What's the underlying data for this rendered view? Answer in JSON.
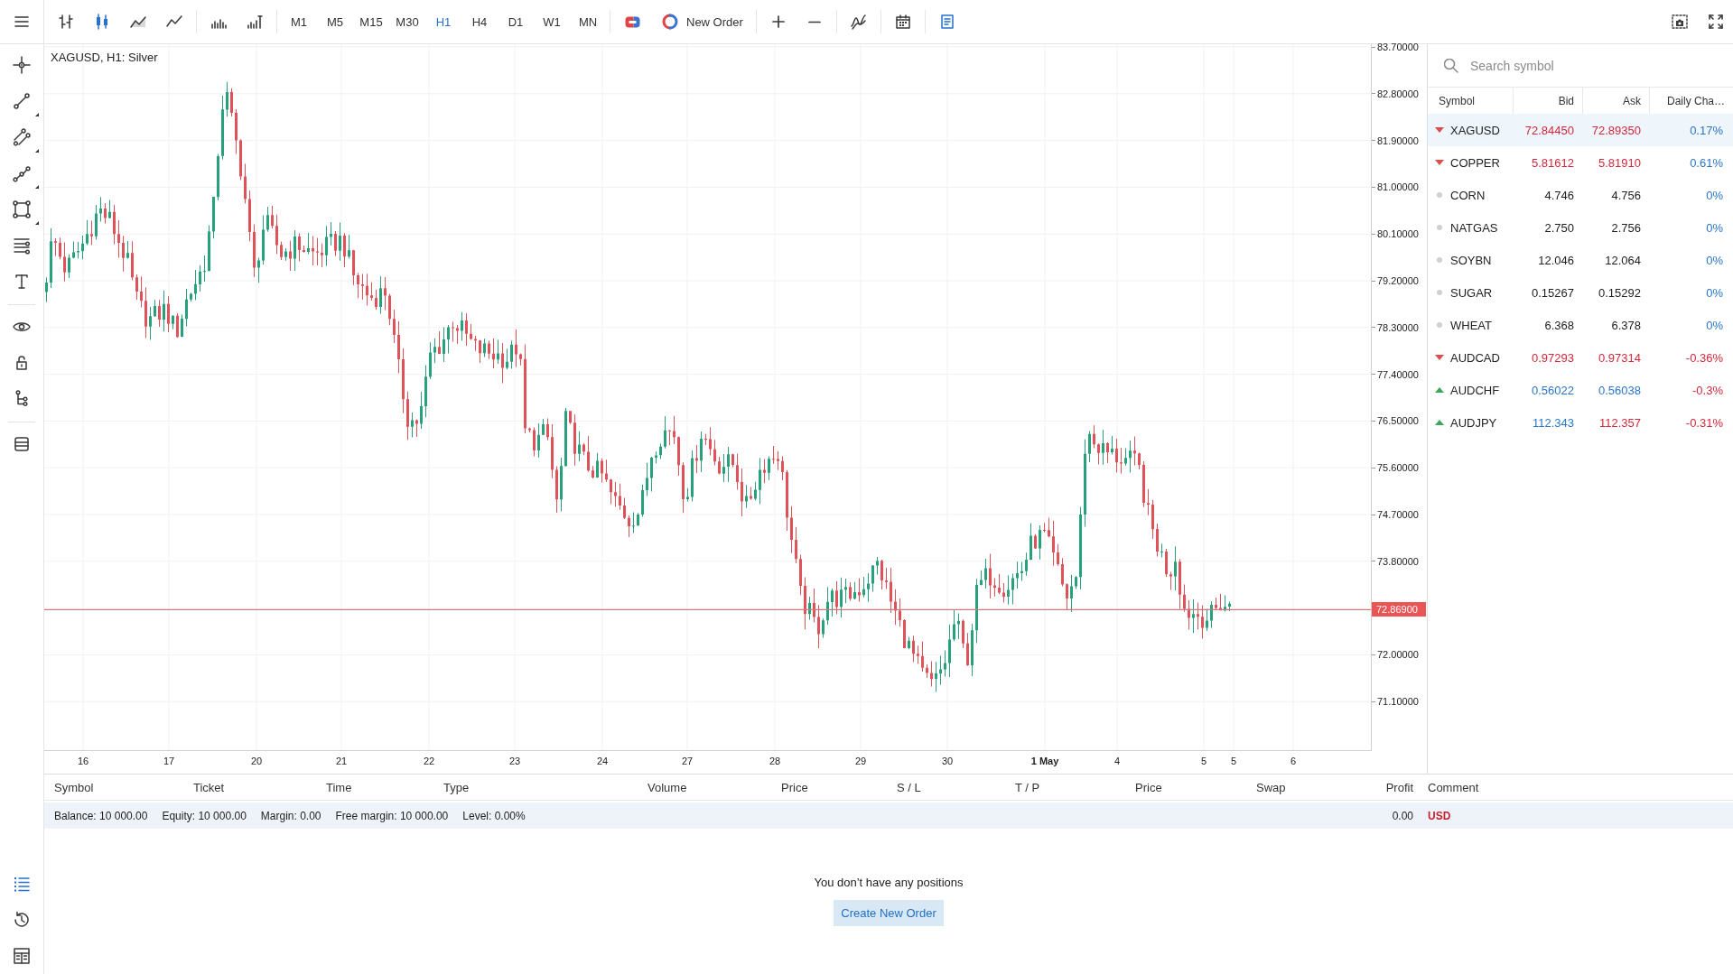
{
  "toolbar": {
    "chart_types": [
      {
        "kind": "bars",
        "selected": false
      },
      {
        "kind": "candles",
        "selected": true
      },
      {
        "kind": "area",
        "selected": false
      },
      {
        "kind": "line",
        "selected": false
      }
    ],
    "timeframes": [
      {
        "label": "M1",
        "selected": false
      },
      {
        "label": "M5",
        "selected": false
      },
      {
        "label": "M15",
        "selected": false
      },
      {
        "label": "M30",
        "selected": false
      },
      {
        "label": "H1",
        "selected": true
      },
      {
        "label": "H4",
        "selected": false
      },
      {
        "label": "D1",
        "selected": false
      },
      {
        "label": "W1",
        "selected": false
      },
      {
        "label": "MN",
        "selected": false
      }
    ],
    "new_order": {
      "label": "New Order"
    },
    "panel_toggle": {
      "on": true
    }
  },
  "sidebar": {
    "bottom_tabs": [
      {
        "kind": "positions",
        "selected": true
      },
      {
        "kind": "history",
        "selected": false
      },
      {
        "kind": "journal",
        "selected": false
      }
    ]
  },
  "chart": {
    "title": "XAGUSD, H1: Silver",
    "price_axis": [
      "83.70000",
      "82.80000",
      "81.90000",
      "81.00000",
      "80.10000",
      "79.20000",
      "78.30000",
      "77.40000",
      "76.50000",
      "75.60000",
      "74.70000",
      "73.80000",
      "72.00000",
      "71.10000"
    ],
    "current_price": "72.86900",
    "date_axis": [
      {
        "label": "16",
        "bold": false
      },
      {
        "label": "17",
        "bold": false
      },
      {
        "label": "20",
        "bold": false
      },
      {
        "label": "21",
        "bold": false
      },
      {
        "label": "22",
        "bold": false
      },
      {
        "label": "23",
        "bold": false
      },
      {
        "label": "24",
        "bold": false
      },
      {
        "label": "27",
        "bold": false
      },
      {
        "label": "28",
        "bold": false
      },
      {
        "label": "29",
        "bold": false
      },
      {
        "label": "30",
        "bold": false
      },
      {
        "label": "1 May",
        "bold": true
      },
      {
        "label": "4",
        "bold": false
      },
      {
        "label": "5",
        "bold": false
      },
      {
        "label": "5",
        "bold": false
      },
      {
        "label": "6",
        "bold": false
      }
    ]
  },
  "watchlist": {
    "search": {
      "placeholder": "Search symbol"
    },
    "columns": [
      "Symbol",
      "Bid",
      "Ask",
      "Daily Cha…"
    ],
    "rows": [
      {
        "symbol": "XAGUSD",
        "bid": "72.84450",
        "ask": "72.89350",
        "change": "0.17%",
        "trend_up": false,
        "trend_down": true,
        "bid_up": false,
        "bid_down": true,
        "ask_up": false,
        "ask_down": true,
        "change_negative": false,
        "selected": true
      },
      {
        "symbol": "COPPER",
        "bid": "5.81612",
        "ask": "5.81910",
        "change": "0.61%",
        "trend_up": false,
        "trend_down": true,
        "bid_up": false,
        "bid_down": true,
        "ask_up": false,
        "ask_down": true,
        "change_negative": false,
        "selected": false
      },
      {
        "symbol": "CORN",
        "bid": "4.746",
        "ask": "4.756",
        "change": "0%",
        "trend_up": false,
        "trend_down": false,
        "bid_up": false,
        "bid_down": false,
        "ask_up": false,
        "ask_down": false,
        "change_negative": false,
        "selected": false
      },
      {
        "symbol": "NATGAS",
        "bid": "2.750",
        "ask": "2.756",
        "change": "0%",
        "trend_up": false,
        "trend_down": false,
        "bid_up": false,
        "bid_down": false,
        "ask_up": false,
        "ask_down": false,
        "change_negative": false,
        "selected": false
      },
      {
        "symbol": "SOYBN",
        "bid": "12.046",
        "ask": "12.064",
        "change": "0%",
        "trend_up": false,
        "trend_down": false,
        "bid_up": false,
        "bid_down": false,
        "ask_up": false,
        "ask_down": false,
        "change_negative": false,
        "selected": false
      },
      {
        "symbol": "SUGAR",
        "bid": "0.15267",
        "ask": "0.15292",
        "change": "0%",
        "trend_up": false,
        "trend_down": false,
        "bid_up": false,
        "bid_down": false,
        "ask_up": false,
        "ask_down": false,
        "change_negative": false,
        "selected": false
      },
      {
        "symbol": "WHEAT",
        "bid": "6.368",
        "ask": "6.378",
        "change": "0%",
        "trend_up": false,
        "trend_down": false,
        "bid_up": false,
        "bid_down": false,
        "ask_up": false,
        "ask_down": false,
        "change_negative": false,
        "selected": false
      },
      {
        "symbol": "AUDCAD",
        "bid": "0.97293",
        "ask": "0.97314",
        "change": "-0.36%",
        "trend_up": false,
        "trend_down": true,
        "bid_up": false,
        "bid_down": true,
        "ask_up": false,
        "ask_down": true,
        "change_negative": true,
        "selected": false
      },
      {
        "symbol": "AUDCHF",
        "bid": "0.56022",
        "ask": "0.56038",
        "change": "-0.3%",
        "trend_up": true,
        "trend_down": false,
        "bid_up": true,
        "bid_down": false,
        "ask_up": true,
        "ask_down": false,
        "change_negative": true,
        "selected": false
      },
      {
        "symbol": "AUDJPY",
        "bid": "112.343",
        "ask": "112.357",
        "change": "-0.31%",
        "trend_up": true,
        "trend_down": false,
        "bid_up": true,
        "bid_down": false,
        "ask_up": false,
        "ask_down": true,
        "change_negative": true,
        "selected": false
      }
    ]
  },
  "positions": {
    "columns": [
      "Symbol",
      "Ticket",
      "Time",
      "Type",
      "Volume",
      "Price",
      "S / L",
      "T / P",
      "Price",
      "Swap",
      "Profit",
      "Comment"
    ],
    "summary": {
      "items": [
        "Balance: 10 000.00",
        "Equity: 10 000.00",
        "Margin: 0.00",
        "Free margin: 10 000.00",
        "Level: 0.00%"
      ],
      "profit": "0.00",
      "currency": "USD"
    },
    "empty_message": "You don’t have any positions",
    "create_button": "Create New Order"
  }
}
